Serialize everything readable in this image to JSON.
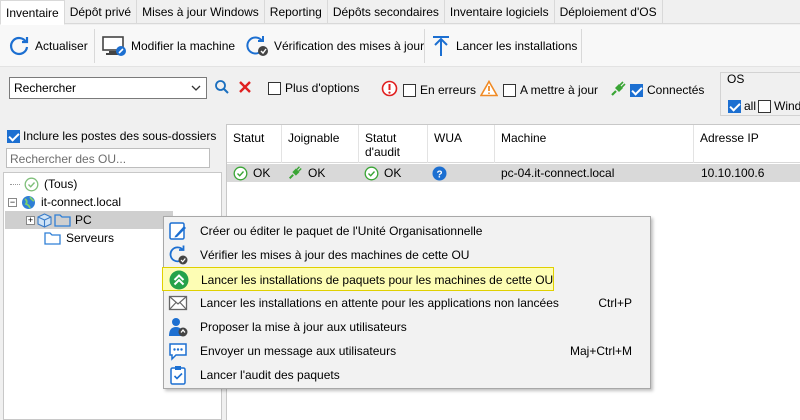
{
  "tabs": [
    "Inventaire",
    "Dépôt privé",
    "Mises à jour Windows",
    "Reporting",
    "Dépôts secondaires",
    "Inventaire logiciels",
    "Déploiement d'OS"
  ],
  "toolbar": {
    "refresh": "Actualiser",
    "edit_machine": "Modifier la machine",
    "check_updates": "Vérification des mises à jour",
    "launch_installs": "Lancer les installations"
  },
  "filters": {
    "search_value": "Rechercher",
    "more_options": "Plus d'options",
    "in_error": "En erreurs",
    "to_update": "A mettre à jour",
    "connected": "Connectés",
    "connected_checked": true
  },
  "os": {
    "title": "OS",
    "all": "all",
    "windows": "Wind"
  },
  "left": {
    "include_subfolders": "Inclure les postes des sous-dossiers",
    "ou_search_placeholder": "Rechercher des OU...",
    "tree": {
      "all": "(Tous)",
      "domain": "it-connect.local",
      "pc": "PC",
      "servers": "Serveurs"
    }
  },
  "grid": {
    "columns": {
      "status": "Statut",
      "reachable": "Joignable",
      "audit_status": "Statut\nd'audit",
      "wua": "WUA",
      "machine": "Machine",
      "ip": "Adresse IP"
    },
    "rows": [
      {
        "status": "OK",
        "reachable": "OK",
        "audit_status": "OK",
        "machine": "pc-04.it-connect.local",
        "ip": "10.10.100.6"
      }
    ]
  },
  "menu": {
    "items": [
      {
        "label": "Créer ou éditer le paquet de l'Unité Organisationnelle",
        "shortcut": ""
      },
      {
        "label": "Vérifier les mises à jour des machines de cette OU",
        "shortcut": ""
      },
      {
        "label": "Lancer les installations de paquets pour les machines de cette OU",
        "shortcut": ""
      },
      {
        "label": "Lancer les installations en attente pour les applications non lancées",
        "shortcut": "Ctrl+P"
      },
      {
        "label": "Proposer la mise à jour aux utilisateurs",
        "shortcut": ""
      },
      {
        "label": "Envoyer un message aux utilisateurs",
        "shortcut": "Maj+Ctrl+M"
      },
      {
        "label": "Lancer l'audit des paquets",
        "shortcut": ""
      }
    ]
  },
  "colors": {
    "accent_blue": "#1c6fd1",
    "ok_green": "#3aa535",
    "error_red": "#e02020",
    "warning_orange": "#f08a24",
    "highlight_yellow": "#fdfdb4"
  }
}
